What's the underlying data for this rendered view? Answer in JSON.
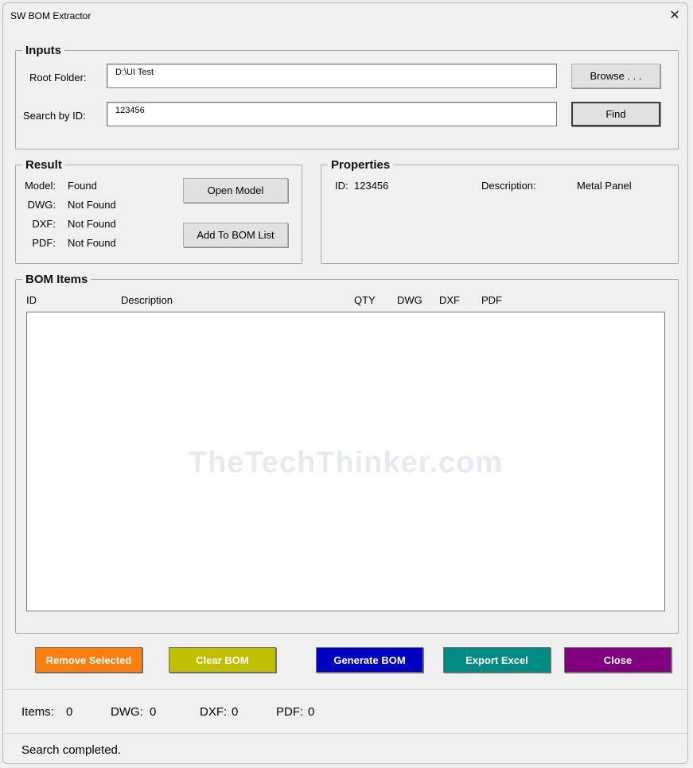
{
  "window": {
    "title": "SW BOM Extractor"
  },
  "inputs": {
    "legend": "Inputs",
    "root_label": "Root Folder:",
    "root_value": "D:\\UI Test",
    "search_label": "Search by ID:",
    "search_value": "123456",
    "browse_label": "Browse . . .",
    "find_label": "Find"
  },
  "result": {
    "legend": "Result",
    "rows": [
      {
        "label": "Model:",
        "value": "Found"
      },
      {
        "label": "DWG:",
        "value": "Not Found"
      },
      {
        "label": "DXF:",
        "value": "Not Found"
      },
      {
        "label": "PDF:",
        "value": "Not Found"
      }
    ],
    "open_model_label": "Open Model",
    "add_bom_label": "Add To BOM List"
  },
  "properties": {
    "legend": "Properties",
    "id_label": "ID:",
    "id_value": "123456",
    "desc_label": "Description:",
    "desc_value": "Metal Panel"
  },
  "bom": {
    "legend": "BOM Items",
    "columns": [
      "ID",
      "Description",
      "QTY",
      "DWG",
      "DXF",
      "PDF"
    ],
    "watermark": "TheTechThinker.com"
  },
  "actions": {
    "remove_selected": "Remove Selected",
    "clear_bom": "Clear BOM",
    "generate_bom": "Generate BOM",
    "export_excel": "Export Excel",
    "close": "Close"
  },
  "colors": {
    "remove_selected": "#ff7f0e",
    "clear_bom": "#c0c000",
    "generate_bom": "#0000c0",
    "export_excel": "#008c84",
    "close": "#800080"
  },
  "counts": {
    "items_label": "Items:",
    "items_value": "0",
    "dwg_label": "DWG:",
    "dwg_value": "0",
    "dxf_label": "DXF:",
    "dxf_value": "0",
    "pdf_label": "PDF:",
    "pdf_value": "0"
  },
  "status": {
    "text": "Search completed."
  }
}
